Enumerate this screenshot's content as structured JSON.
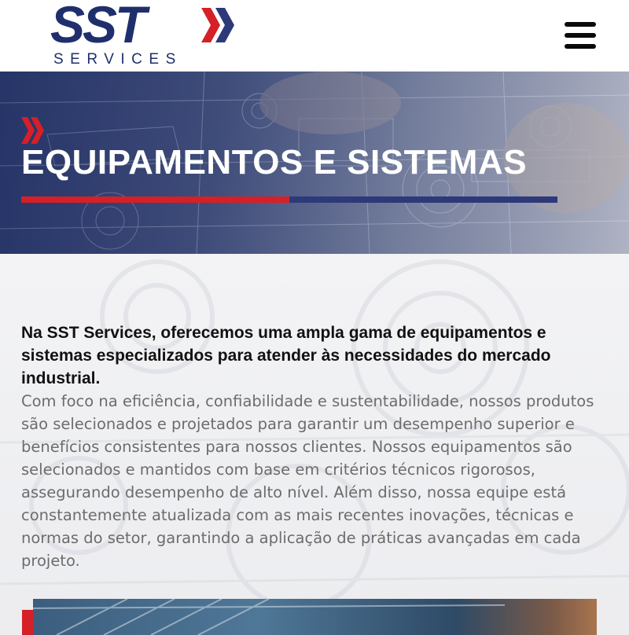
{
  "header": {
    "logo_text": "SST",
    "logo_subtext": "SERVICES",
    "menu_icon": "hamburger-icon"
  },
  "hero": {
    "icon": "double-chevron-right-icon",
    "title": "EQUIPAMENTOS E SISTEMAS"
  },
  "content": {
    "intro_bold": "Na SST Services, oferecemos uma ampla gama de equipamentos e sistemas especializados para atender às necessidades do mercado industrial.",
    "intro_body": "Com foco na eficiência, confiabilidade e sustentabilidade, nossos produtos são selecionados e projetados para garantir um desempenho superior e benefícios consistentes para nossos clientes. Nossos equipamentos são selecionados e mantidos com base em critérios técnicos rigorosos, assegurando desempenho de alto nível. Além disso, nossa equipe está constantemente atualizada com as mais recentes inovações, técnicas e normas do setor, garantindo a aplicação de práticas avançadas em cada projeto."
  },
  "colors": {
    "brand_blue": "#1f2f6e",
    "brand_red": "#d52027",
    "bar_blue": "#2d3979",
    "body_text": "#6c6c6c",
    "heading_text": "#111111"
  }
}
